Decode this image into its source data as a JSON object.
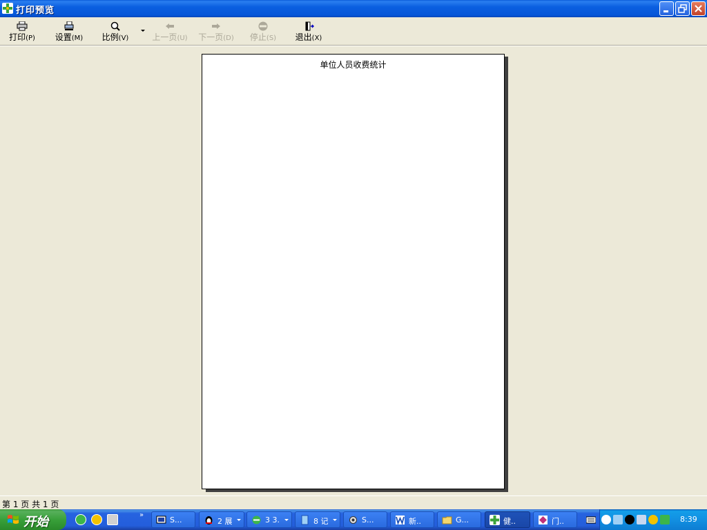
{
  "window": {
    "title": "打印预览"
  },
  "toolbar": {
    "buttons": [
      {
        "label": "打印",
        "mnemonic": "(P)",
        "icon": "printer-icon",
        "enabled": true
      },
      {
        "label": "设置",
        "mnemonic": "(M)",
        "icon": "page-setup-icon",
        "enabled": true
      },
      {
        "label": "比例",
        "mnemonic": "(V)",
        "icon": "zoom-icon",
        "enabled": true
      },
      {
        "label": "上一页",
        "mnemonic": "(U)",
        "icon": "arrow-left-icon",
        "enabled": false
      },
      {
        "label": "下一页",
        "mnemonic": "(D)",
        "icon": "arrow-right-icon",
        "enabled": false
      },
      {
        "label": "停止",
        "mnemonic": "(S)",
        "icon": "stop-icon",
        "enabled": false
      },
      {
        "label": "退出",
        "mnemonic": "(X)",
        "icon": "exit-door-icon",
        "enabled": true
      }
    ]
  },
  "preview": {
    "page_title": "单位人员收费统计"
  },
  "status": {
    "text": "第 1 页 共 1 页"
  },
  "taskbar": {
    "start_label": "开始",
    "tasks": [
      {
        "label": "S...",
        "icon": "terminal-icon"
      },
      {
        "label": "2 展",
        "icon": "qq-penguin-icon",
        "group": true
      },
      {
        "label": "3 3.",
        "icon": "ie-browser-icon",
        "group": true
      },
      {
        "label": "8 记",
        "icon": "notepad-icon",
        "group": true
      },
      {
        "label": "S...",
        "icon": "gear-icon"
      },
      {
        "label": "新..",
        "icon": "word-icon"
      },
      {
        "label": "G...",
        "icon": "folder-icon"
      },
      {
        "label": "健..",
        "icon": "app-cross-icon",
        "active": true
      },
      {
        "label": "门..",
        "icon": "app-diamond-icon"
      }
    ],
    "clock": "8:39"
  },
  "colors": {
    "titlebar": "#0a5bd9",
    "face": "#ece9d8",
    "taskbar": "#245edb",
    "start": "#39a03a",
    "tray": "#1290e2"
  }
}
